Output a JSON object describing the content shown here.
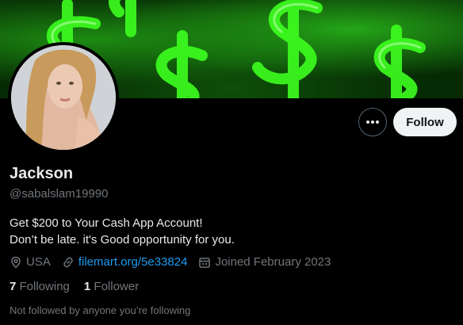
{
  "profile": {
    "name": "Jackson",
    "handle": "@sabalslam19990",
    "bio_line1": "Get $200 to Your Cash App Account!",
    "bio_line2": "Don’t be late. it's Good opportunity for you.",
    "location": "USA",
    "website": "filemart.org/5e33824",
    "joined": "Joined February 2023",
    "following_count": "7",
    "following_label": "Following",
    "followers_count": "1",
    "followers_label": "Follower",
    "followed_by_note": "Not followed by anyone you’re following"
  },
  "actions": {
    "follow_label": "Follow"
  },
  "icons": {
    "more": "more-horizontal-icon",
    "location": "location-pin-icon",
    "website": "link-icon",
    "joined": "calendar-icon"
  },
  "colors": {
    "background": "#000000",
    "link": "#1d9bf0",
    "secondary_text": "#71767b",
    "follow_button": "#eff3f4",
    "banner_green": "#39ff14"
  }
}
